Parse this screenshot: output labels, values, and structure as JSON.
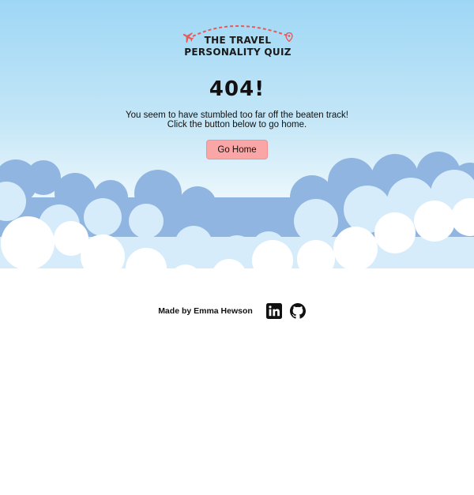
{
  "logo": {
    "line1": "THE TRAVEL",
    "line2": "PERSONALITY QUIZ",
    "icons": [
      "airplane-icon",
      "location-pin-icon"
    ]
  },
  "page": {
    "title": "404!",
    "message_line1": "You seem to have stumbled too far off the beaten track!",
    "message_line2": "Click the button below to go home.",
    "button_label": "Go Home"
  },
  "footer": {
    "credit": "Made by Emma Hewson",
    "social_icons": [
      "linkedin-icon",
      "github-icon"
    ]
  },
  "colors": {
    "sky_top": "#9ed7f5",
    "cloud_back": "#8fb5e0",
    "cloud_mid": "#d6ecfa",
    "cloud_front": "#ffffff",
    "button": "#fba6a6",
    "accent": "#e85a5a"
  }
}
